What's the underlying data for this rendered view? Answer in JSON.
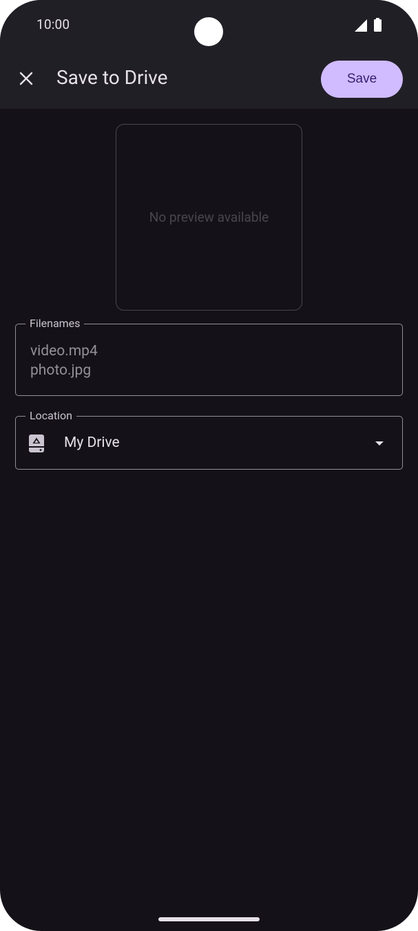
{
  "status_bar": {
    "time": "10:00"
  },
  "app_bar": {
    "title": "Save to Drive",
    "close_icon": "close-icon",
    "save_label": "Save"
  },
  "preview": {
    "text": "No preview available"
  },
  "filenames_field": {
    "label": "Filenames",
    "value": "video.mp4\nphoto.jpg"
  },
  "location_field": {
    "label": "Location",
    "value": "My Drive",
    "icon": "drive-icon"
  },
  "colors": {
    "background": "#141218",
    "app_bar": "#211f26",
    "accent": "#d0bcff",
    "on_accent": "#381e72"
  }
}
